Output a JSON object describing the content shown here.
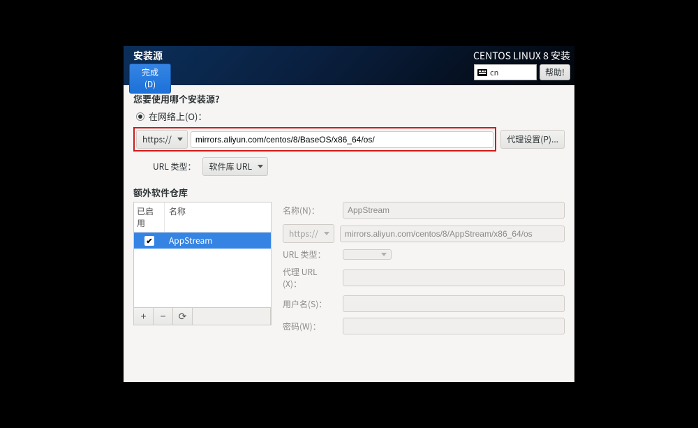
{
  "header": {
    "page_title": "安装源",
    "done_label": "完成(D)",
    "product_title": "CENTOS LINUX 8 安装",
    "input_indicator": "cn",
    "help_label": "帮助!"
  },
  "source": {
    "question_label": "您要使用哪个安装源?",
    "on_network_label": "在网络上(O)：",
    "protocol_selected": "https://",
    "url_value": "mirrors.aliyun.com/centos/8/BaseOS/x86_64/os/",
    "proxy_button": "代理设置(P)...",
    "url_type_label": "URL 类型：",
    "url_type_selected": "软件库 URL"
  },
  "repos": {
    "section_label": "额外软件仓库",
    "col_enabled": "已启用",
    "col_name": "名称",
    "items": [
      {
        "enabled": true,
        "name": "AppStream"
      }
    ],
    "toolbar": {
      "add": "+",
      "remove": "−",
      "refresh": "⟳"
    }
  },
  "detail": {
    "name_label": "名称(N)：",
    "name_value": "AppStream",
    "protocol_selected": "https://",
    "url_value": "mirrors.aliyun.com/centos/8/AppStream/x86_64/os",
    "url_type_label": "URL 类型：",
    "proxy_url_label": "代理 URL (X)：",
    "user_label": "用户名(S)：",
    "password_label": "密码(W)："
  }
}
